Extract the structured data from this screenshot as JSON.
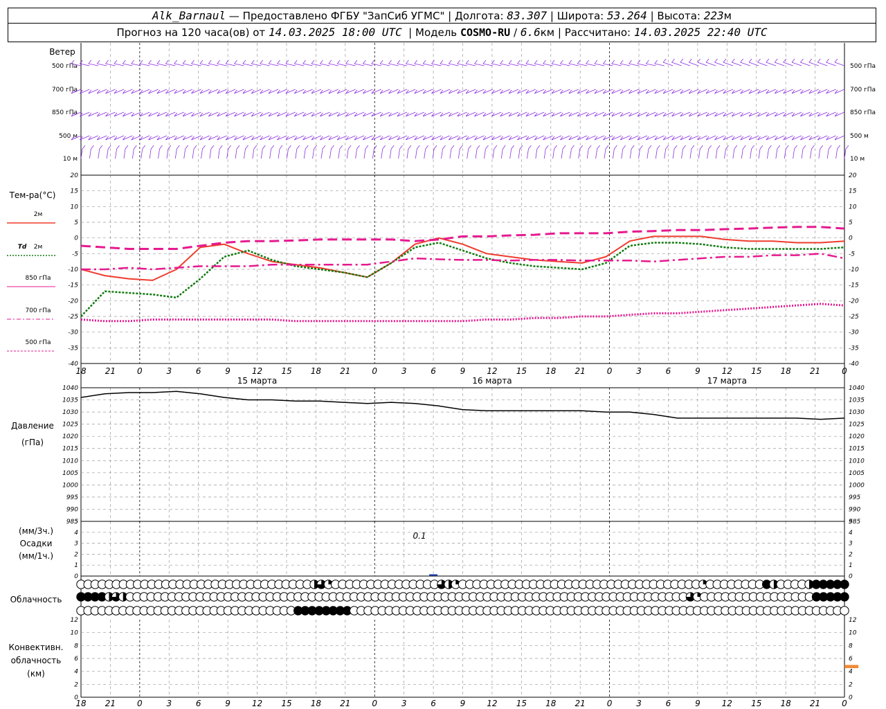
{
  "header": {
    "station": "Alk_Barnaul",
    "dash": "—",
    "provider": "Предоставлено ФГБУ \"ЗапСиб УГМС\"",
    "lon_label": "Долгота:",
    "lon": "83.307",
    "lat_label": "Широта:",
    "lat": "53.264",
    "alt_label": "Высота:",
    "alt": "223",
    "alt_unit": "м",
    "forecast_prefix": "Прогноз на 120 часа(ов) от",
    "forecast_time": "14.03.2025 18:00 UTC",
    "model_label": "Модель",
    "model": "COSMO-RU",
    "resolution": "6.6",
    "resolution_unit": "км",
    "calc_label": "Рассчитано:",
    "calc_time": "14.03.2025 22:40 UTC",
    "sep": "|",
    "slash": "/"
  },
  "colors": {
    "wind": "#8a2be2",
    "t2m": "#ef3b2c",
    "td": "#0f7a0f",
    "t850": "#e6198f",
    "t700": "#e6198f",
    "t500": "#e6198f",
    "pressure": "#000000",
    "grid": "#999999",
    "precip": "#1f3fbf",
    "convective": "#f08c3a"
  },
  "time_axis": {
    "hour_labels": [
      "18",
      "21",
      "0",
      "3",
      "6",
      "9",
      "12",
      "15",
      "18",
      "21",
      "0",
      "3",
      "6",
      "9",
      "12",
      "15",
      "18",
      "21",
      "0",
      "3",
      "6",
      "9",
      "12",
      "15",
      "18",
      "21",
      "0"
    ],
    "day_labels": [
      "15 марта",
      "16 марта",
      "17 марта"
    ]
  },
  "labels": {
    "wind": "Ветер",
    "wind_levels": [
      "500 гПа",
      "700 гПа",
      "850 гПа",
      "500 м",
      "10 м"
    ],
    "temp_title": "Тем-ра(°C)",
    "legend_2m": "2м",
    "legend_td": "Td",
    "legend_td_2m": "2м",
    "legend_850": "850 гПа",
    "legend_700": "700 гПа",
    "legend_500": "500 гПа",
    "pressure_1": "Давление",
    "pressure_2": "(гПа)",
    "precip_1": "(мм/3ч.)",
    "precip_2": "Осадки",
    "precip_3": "(мм/1ч.)",
    "precip_annotation": "0.1",
    "cloud": "Облачность",
    "conv_1": "Конвективн.",
    "conv_2": "облачность",
    "conv_3": "(км)"
  },
  "chart_data": [
    {
      "type": "line",
      "panel": "temperature",
      "x_hours": [
        0,
        3,
        6,
        9,
        12,
        15,
        18,
        21,
        24,
        27,
        30,
        33,
        36,
        39,
        42,
        45,
        48,
        51,
        54,
        57,
        60,
        63,
        66,
        69,
        72,
        75,
        78
      ],
      "ylim": [
        -40,
        20
      ],
      "y_ticks": [
        20,
        15,
        10,
        5,
        0,
        -5,
        -10,
        -15,
        -20,
        -25,
        -30,
        -35,
        -40
      ],
      "grid": true,
      "series": [
        {
          "name": "2м",
          "values": [
            -10,
            -12,
            -13,
            -13.5,
            -10,
            -3,
            -2,
            -5,
            -7.5,
            -8.5,
            -9.5,
            -11,
            -12.5,
            -8,
            -2,
            0,
            -2,
            -5,
            -6,
            -7,
            -7.5,
            -8,
            -6,
            -1,
            0.5,
            0.5,
            0.5,
            -0.5,
            -1,
            -1,
            -1.5,
            -1.5,
            -1
          ]
        },
        {
          "name": "Td",
          "values": [
            -25,
            -17,
            -17.5,
            -18,
            -19,
            -13,
            -6,
            -4,
            -7,
            -9,
            -10,
            -11,
            -12.5,
            -8,
            -3,
            -1.5,
            -4,
            -6.5,
            -8,
            -9,
            -9.5,
            -10,
            -8,
            -2.5,
            -1.5,
            -1.5,
            -2,
            -3,
            -3.5,
            -3.5,
            -3.5,
            -3.5,
            -3
          ]
        },
        {
          "name": "850 гПа",
          "values": [
            -2.5,
            -3,
            -3.5,
            -3.5,
            -3.5,
            -2.5,
            -1.5,
            -1,
            -1,
            -0.8,
            -0.5,
            -0.5,
            -0.5,
            -0.5,
            -1,
            -0.5,
            0.5,
            0.5,
            0.8,
            1,
            1.5,
            1.5,
            1.5,
            2,
            2.2,
            2.5,
            2.5,
            2.8,
            3,
            3.3,
            3.5,
            3.5,
            3
          ]
        },
        {
          "name": "700 гПа",
          "values": [
            -10,
            -10,
            -9.5,
            -10,
            -9.5,
            -9,
            -9,
            -9,
            -8.5,
            -8.5,
            -8.5,
            -8.5,
            -8.5,
            -7.5,
            -6.5,
            -6.8,
            -7,
            -7,
            -7.2,
            -7,
            -7,
            -7.2,
            -7.2,
            -7.2,
            -7.5,
            -7,
            -6.5,
            -6,
            -6,
            -5.5,
            -5.5,
            -5,
            -6.5
          ]
        },
        {
          "name": "500 гПа",
          "values": [
            -26,
            -26.5,
            -26.5,
            -26,
            -26,
            -26,
            -26,
            -26,
            -26,
            -26.5,
            -26.5,
            -26.5,
            -26.5,
            -26.5,
            -26.5,
            -26.5,
            -26.5,
            -26,
            -26,
            -25.5,
            -25.5,
            -25,
            -25,
            -24.5,
            -24,
            -24,
            -23.5,
            -23,
            -22.5,
            -22,
            -21.5,
            -21,
            -21.5
          ]
        }
      ]
    },
    {
      "type": "line",
      "panel": "pressure",
      "ylim": [
        985,
        1040
      ],
      "y_ticks": [
        1040,
        1035,
        1030,
        1025,
        1020,
        1015,
        1010,
        1005,
        1000,
        995,
        990,
        985
      ],
      "grid": true,
      "series": [
        {
          "name": "Давление",
          "values": [
            1036,
            1037.5,
            1038,
            1038,
            1038.5,
            1037.5,
            1036,
            1035,
            1035,
            1034.5,
            1034.5,
            1034,
            1033.5,
            1034,
            1033.5,
            1032.5,
            1031,
            1030.5,
            1030.5,
            1030.5,
            1030.5,
            1030.5,
            1030,
            1030,
            1029,
            1027.5,
            1027.5,
            1027.5,
            1027.5,
            1027.5,
            1027.5,
            1027,
            1027.5
          ]
        }
      ]
    },
    {
      "type": "bar",
      "panel": "precipitation",
      "ylim": [
        0,
        5
      ],
      "y_ticks": [
        5,
        4,
        3,
        2,
        1,
        0
      ],
      "values": [
        {
          "hour": 36,
          "value": 0.1
        }
      ]
    },
    {
      "type": "table",
      "panel": "cloud_cover",
      "rows": [
        {
          "level": "upper",
          "coverage": [
            0,
            0,
            0,
            0,
            0,
            0,
            0,
            0,
            0,
            0,
            0,
            0,
            0,
            0,
            0,
            0,
            0,
            0,
            0,
            0,
            0,
            0,
            0,
            0,
            0,
            0,
            0,
            0,
            0,
            0,
            0,
            0,
            0,
            0.5,
            0.75,
            0.25,
            0,
            0,
            0,
            0,
            0,
            0,
            0,
            0,
            0,
            0,
            0,
            0,
            0,
            0,
            0,
            0.75,
            0.5,
            0.25,
            0,
            0,
            0,
            0,
            0,
            0,
            0,
            0,
            0,
            0,
            0,
            0,
            0,
            0,
            0,
            0,
            0,
            0,
            0,
            0,
            0,
            0,
            0,
            0,
            0,
            0,
            0,
            0,
            0,
            0,
            0,
            0,
            0,
            0,
            0.25,
            0,
            0,
            0,
            0,
            0,
            0,
            0,
            0,
            1,
            0.5,
            0,
            0,
            0,
            0,
            0.5,
            1,
            1,
            1,
            1,
            1
          ]
        },
        {
          "level": "middle",
          "coverage": [
            1,
            1,
            1,
            1,
            0.5,
            0.75,
            0.5,
            0,
            0,
            0,
            0,
            0,
            0,
            0,
            0,
            0,
            0,
            0,
            0,
            0,
            0,
            0,
            0,
            0,
            0,
            0,
            0,
            0,
            0,
            0,
            0,
            0,
            0,
            0,
            0,
            0,
            0,
            0,
            0,
            0,
            0,
            0,
            0,
            0,
            0,
            0,
            0,
            0,
            0,
            0,
            0,
            0,
            0,
            0,
            0,
            0,
            0,
            0,
            0,
            0,
            0,
            0,
            0,
            0,
            0,
            0,
            0,
            0,
            0,
            0,
            0,
            0,
            0,
            0,
            0,
            0,
            0,
            0,
            0,
            0,
            0,
            0,
            0,
            0,
            0,
            0,
            0,
            0.75,
            0.25,
            0,
            0,
            0,
            0,
            0,
            0,
            0,
            0,
            0,
            0,
            0,
            0,
            0,
            0,
            0,
            0,
            1,
            1,
            1,
            1,
            1
          ]
        },
        {
          "level": "lower",
          "coverage": [
            0,
            0,
            0,
            0,
            0,
            0,
            0,
            0,
            0,
            0,
            0,
            0,
            0,
            0,
            0,
            0,
            0,
            0,
            0,
            0,
            0,
            0,
            0,
            0,
            0,
            0,
            0,
            0,
            0,
            0,
            0,
            1,
            1,
            1,
            1,
            1,
            1,
            1,
            1,
            0,
            0,
            0,
            0,
            0,
            0,
            0,
            0,
            0,
            0,
            0,
            0,
            0,
            0,
            0,
            0,
            0,
            0,
            0,
            0,
            0,
            0,
            0,
            0,
            0,
            0,
            0,
            0,
            0,
            0,
            0,
            0,
            0,
            0,
            0,
            0,
            0,
            0,
            0,
            0,
            0,
            0,
            0,
            0,
            0,
            0,
            0,
            0,
            0,
            0,
            0,
            0,
            0,
            0,
            0,
            0,
            0,
            0,
            0,
            0,
            0,
            0,
            0,
            0,
            0,
            0,
            0,
            0,
            0,
            0,
            0
          ]
        }
      ]
    },
    {
      "type": "bar",
      "panel": "convective_cloud",
      "ylim": [
        0,
        12
      ],
      "y_ticks": [
        12,
        10,
        8,
        6,
        4,
        2,
        0
      ],
      "values": [
        {
          "hour": 79,
          "base_km": 4.5,
          "top_km": 5
        }
      ]
    }
  ]
}
